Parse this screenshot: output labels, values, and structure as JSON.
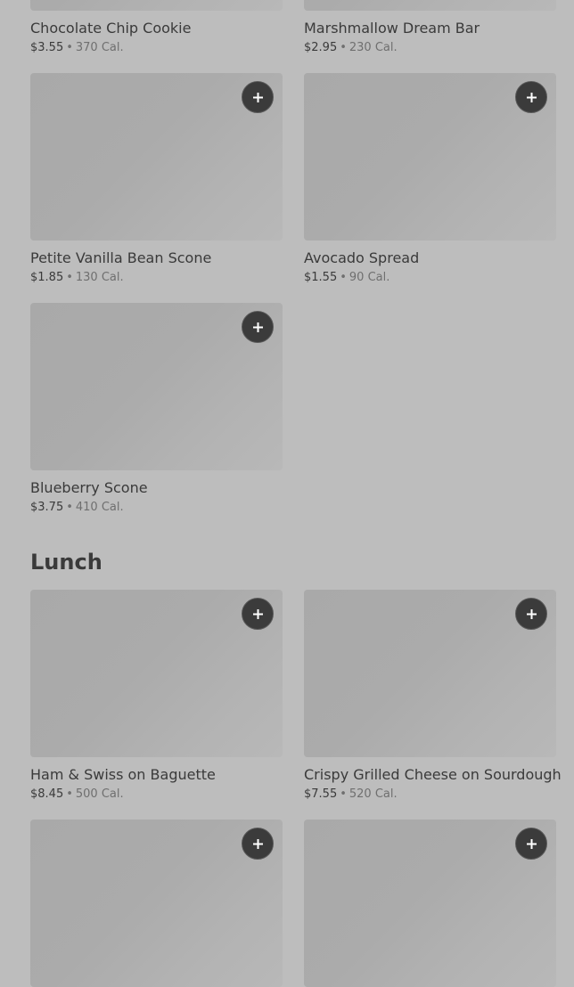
{
  "items": [
    {
      "name": "Chocolate Chip Cookie",
      "price": "$3.55",
      "separator": "•",
      "calories": "370 Cal."
    },
    {
      "name": "Marshmallow Dream Bar",
      "price": "$2.95",
      "separator": "•",
      "calories": "230 Cal."
    },
    {
      "name": "Petite Vanilla Bean Scone",
      "price": "$1.85",
      "separator": "•",
      "calories": "130 Cal."
    },
    {
      "name": "Avocado Spread",
      "price": "$1.55",
      "separator": "•",
      "calories": "90 Cal."
    },
    {
      "name": "Blueberry Scone",
      "price": "$3.75",
      "separator": "•",
      "calories": "410 Cal."
    }
  ],
  "lunch": {
    "title": "Lunch",
    "items": [
      {
        "name": "Ham & Swiss on Baguette",
        "price": "$8.45",
        "separator": "•",
        "calories": "500 Cal."
      },
      {
        "name": "Crispy Grilled Cheese on Sourdough",
        "price": "$7.55",
        "separator": "•",
        "calories": "520 Cal."
      }
    ]
  },
  "icons": {
    "add": "plus-icon"
  },
  "colors": {
    "background": "#bdbdbd",
    "add_button": "#3b3b3b",
    "text": "#3a3a3a",
    "muted_text": "#6f6f6f"
  }
}
